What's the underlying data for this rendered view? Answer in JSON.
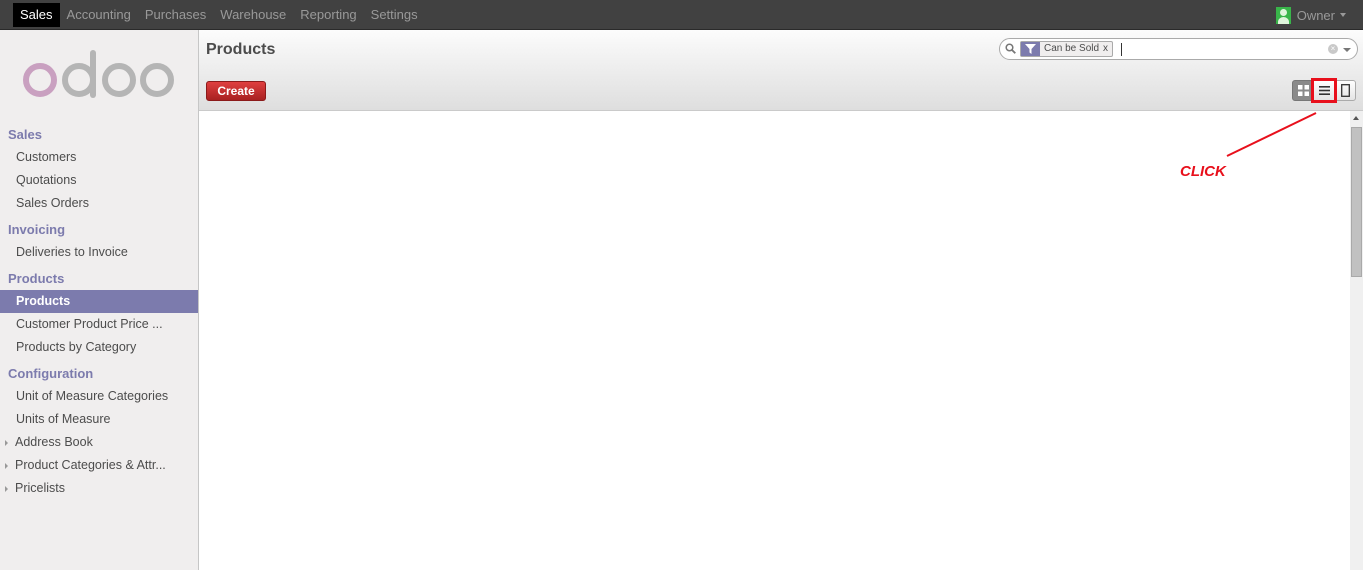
{
  "topbar": {
    "menu": [
      {
        "label": "Sales",
        "active": true
      },
      {
        "label": "Accounting",
        "active": false
      },
      {
        "label": "Purchases",
        "active": false
      },
      {
        "label": "Warehouse",
        "active": false
      },
      {
        "label": "Reporting",
        "active": false
      },
      {
        "label": "Settings",
        "active": false
      }
    ],
    "user": "Owner"
  },
  "sidebar": {
    "logo": "odoo",
    "sections": [
      {
        "title": "Sales",
        "items": [
          "Customers",
          "Quotations",
          "Sales Orders"
        ]
      },
      {
        "title": "Invoicing",
        "items": [
          "Deliveries to Invoice"
        ]
      },
      {
        "title": "Products",
        "items": [
          "Products",
          "Customer Product Price ...",
          "Products by Category"
        ]
      },
      {
        "title": "Configuration",
        "items": [
          "Unit of Measure Categories",
          "Units of Measure"
        ]
      }
    ],
    "collapsed": [
      "Address Book",
      "Product Categories & Attr...",
      "Pricelists"
    ],
    "active_item": "Products"
  },
  "header": {
    "title": "Products",
    "create_label": "Create"
  },
  "search": {
    "facet": "Can be Sold",
    "facet_close": "x",
    "clear": "×"
  },
  "views": [
    "kanban-view",
    "list-view",
    "form-view"
  ],
  "annotation": {
    "label": "CLICK",
    "color": "#e8101c"
  },
  "colors": {
    "accent": "#7c7bad",
    "create": "#c02c2c"
  }
}
